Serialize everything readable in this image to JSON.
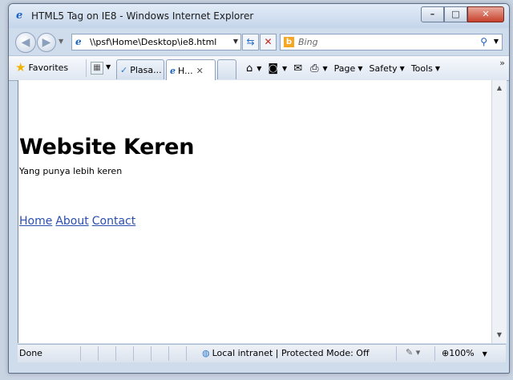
{
  "window": {
    "title": "HTML5 Tag on IE8 - Windows Internet Explorer",
    "caption": {
      "minimize": "–",
      "maximize": "□",
      "close": "✕"
    }
  },
  "address": {
    "url": "\\\\psf\\Home\\Desktop\\ie8.html",
    "search_placeholder": "Bing"
  },
  "command_bar": {
    "favorites_label": "Favorites",
    "tabs": [
      {
        "label": "Plasa...",
        "icon": "plasa-icon"
      },
      {
        "label": "H...",
        "icon": "ie-page-icon",
        "active": true
      },
      {
        "label": "",
        "icon": "new-tab"
      }
    ],
    "tools": [
      {
        "name": "home-icon",
        "glyph": "⌂"
      },
      {
        "name": "feeds-icon",
        "glyph": "◙"
      },
      {
        "name": "read-mail-icon",
        "glyph": "✉"
      },
      {
        "name": "print-icon",
        "glyph": "⎙"
      }
    ],
    "menus": [
      "Page",
      "Safety",
      "Tools"
    ]
  },
  "page": {
    "heading": "Website Keren",
    "tagline": "Yang punya lebih keren",
    "nav": [
      "Home",
      "About",
      "Contact"
    ]
  },
  "status": {
    "left": "Done",
    "zone": "Local intranet | Protected Mode: Off",
    "zoom": "100%"
  },
  "colors": {
    "link": "#2a4fb0",
    "chrome": "#cfdcec"
  }
}
